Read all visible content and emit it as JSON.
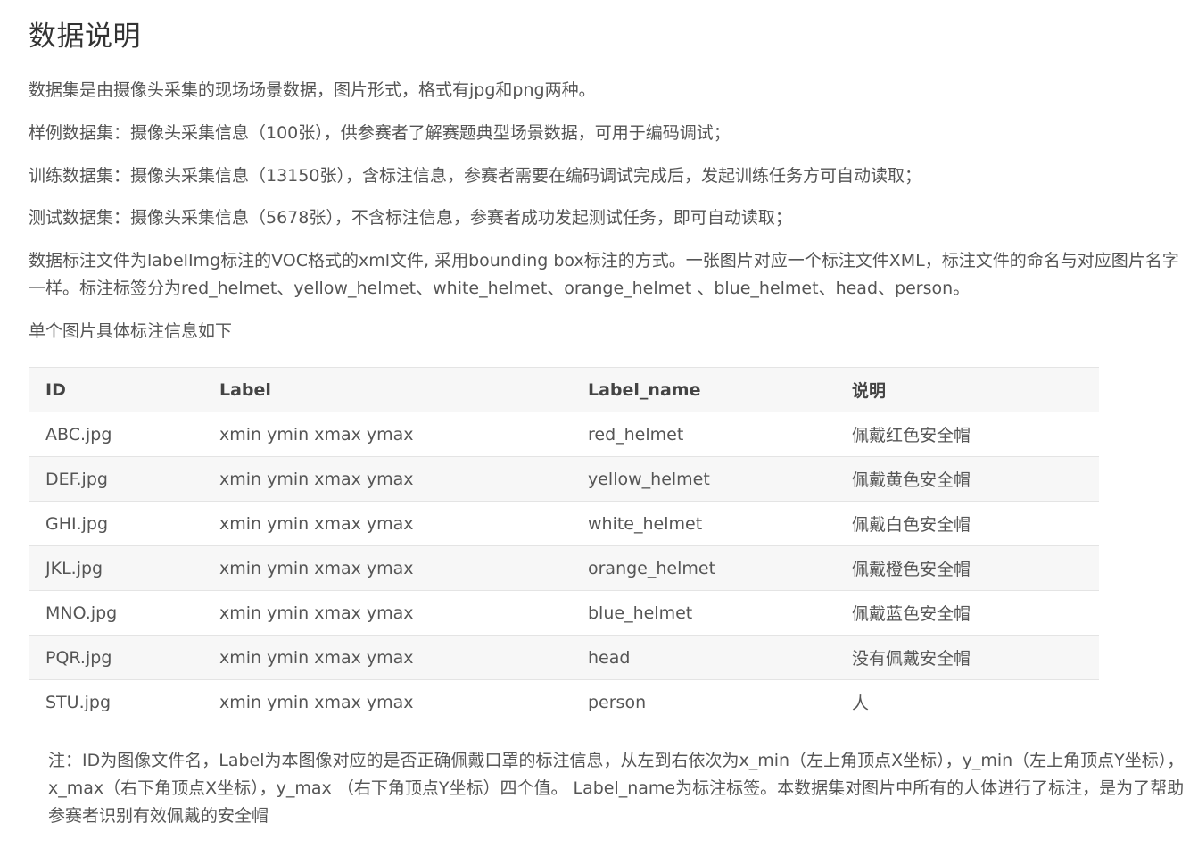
{
  "title": "数据说明",
  "paragraphs": {
    "p1": "数据集是由摄像头采集的现场场景数据，图片形式，格式有jpg和png两种。",
    "p2": "样例数据集：摄像头采集信息（100张），供参赛者了解赛题典型场景数据，可用于编码调试；",
    "p3": "训练数据集：摄像头采集信息（13150张），含标注信息，参赛者需要在编码调试完成后，发起训练任务方可自动读取；",
    "p4": "测试数据集：摄像头采集信息（5678张），不含标注信息，参赛者成功发起测试任务，即可自动读取；",
    "p5": "数据标注文件为labelImg标注的VOC格式的xml文件, 采用bounding box标注的方式。一张图片对应一个标注文件XML，标注文件的命名与对应图片名字一样。标注标签分为red_helmet、yellow_helmet、white_helmet、orange_helmet 、blue_helmet、head、person。",
    "p6": "单个图片具体标注信息如下"
  },
  "table": {
    "headers": {
      "id": "ID",
      "label": "Label",
      "label_name": "Label_name",
      "desc": "说明"
    },
    "rows": [
      {
        "id": "ABC.jpg",
        "label": "xmin ymin xmax ymax",
        "label_name": "red_helmet",
        "desc": "佩戴红色安全帽"
      },
      {
        "id": "DEF.jpg",
        "label": "xmin ymin xmax ymax",
        "label_name": "yellow_helmet",
        "desc": "佩戴黄色安全帽"
      },
      {
        "id": "GHI.jpg",
        "label": "xmin ymin xmax ymax",
        "label_name": "white_helmet",
        "desc": "佩戴白色安全帽"
      },
      {
        "id": "JKL.jpg",
        "label": "xmin ymin xmax ymax",
        "label_name": "orange_helmet",
        "desc": "佩戴橙色安全帽"
      },
      {
        "id": "MNO.jpg",
        "label": "xmin ymin xmax ymax",
        "label_name": "blue_helmet",
        "desc": "佩戴蓝色安全帽"
      },
      {
        "id": "PQR.jpg",
        "label": "xmin ymin xmax ymax",
        "label_name": "head",
        "desc": "没有佩戴安全帽"
      },
      {
        "id": "STU.jpg",
        "label": "xmin ymin xmax ymax",
        "label_name": "person",
        "desc": "人"
      }
    ]
  },
  "note": "注：ID为图像文件名，Label为本图像对应的是否正确佩戴口罩的标注信息，从左到右依次为x_min（左上角顶点X坐标），y_min（左上角顶点Y坐标），x_max（右下角顶点X坐标），y_max （右下角顶点Y坐标）四个值。 Label_name为标注标签。本数据集对图片中所有的人体进行了标注，是为了帮助参赛者识别有效佩戴的安全帽",
  "colors": {
    "text": "#555555",
    "title": "#333333",
    "row_alt_bg": "#f7f7f7",
    "border": "#e4e4e4"
  }
}
